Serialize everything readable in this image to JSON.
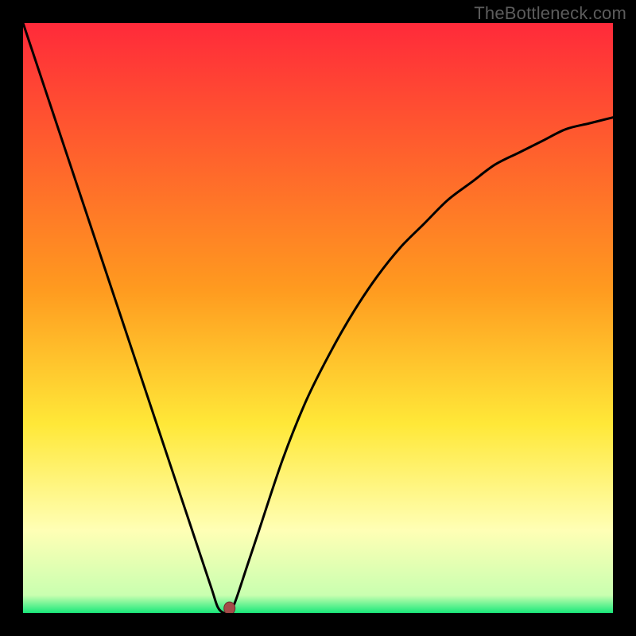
{
  "watermark": "TheBottleneck.com",
  "colors": {
    "frame": "#000000",
    "curve": "#000000",
    "marker_fill": "#a44b49",
    "marker_stroke": "#6b2d2a",
    "watermark": "#5c5c5c",
    "gradient_top": "#ff2a3a",
    "gradient_mid_upper": "#ff9a1f",
    "gradient_mid": "#ffe838",
    "gradient_mid_lower": "#ffffb5",
    "gradient_bottom": "#19e87a"
  },
  "chart_data": {
    "type": "line",
    "title": "",
    "xlabel": "",
    "ylabel": "",
    "x_range": [
      0,
      100
    ],
    "y_range": [
      0,
      100
    ],
    "series": [
      {
        "name": "bottleneck-curve",
        "x": [
          0,
          4,
          8,
          12,
          16,
          20,
          24,
          28,
          30,
          32,
          33,
          34,
          35,
          36,
          38,
          40,
          44,
          48,
          52,
          56,
          60,
          64,
          68,
          72,
          76,
          80,
          84,
          88,
          92,
          96,
          100
        ],
        "y": [
          100,
          88,
          76,
          64,
          52,
          40,
          28,
          16,
          10,
          4,
          1,
          0,
          0,
          2,
          8,
          14,
          26,
          36,
          44,
          51,
          57,
          62,
          66,
          70,
          73,
          76,
          78,
          80,
          82,
          83,
          84
        ]
      }
    ],
    "marker": {
      "x": 35,
      "y": 0.8
    },
    "gradient_stops": [
      {
        "pos": 0.0,
        "color": "#ff2a3a"
      },
      {
        "pos": 0.45,
        "color": "#ff9a1f"
      },
      {
        "pos": 0.68,
        "color": "#ffe838"
      },
      {
        "pos": 0.86,
        "color": "#ffffb5"
      },
      {
        "pos": 0.97,
        "color": "#c9ffb0"
      },
      {
        "pos": 1.0,
        "color": "#19e87a"
      }
    ]
  }
}
